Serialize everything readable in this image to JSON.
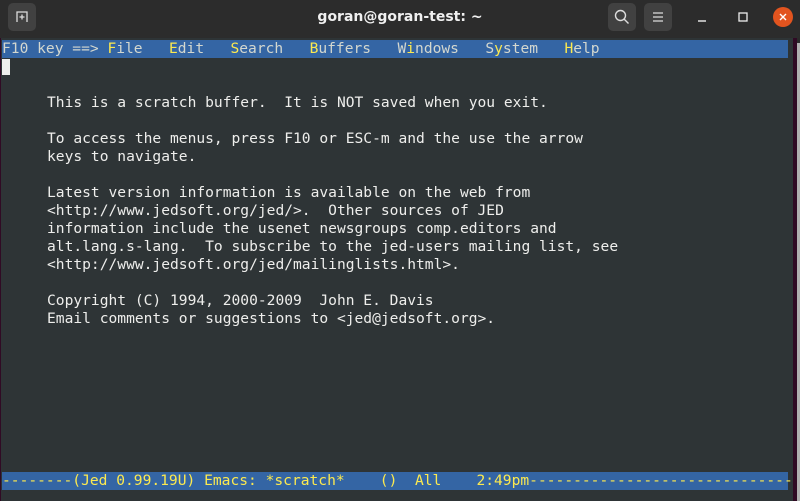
{
  "window": {
    "title": "goran@goran-test: ~",
    "icons": [
      "new-tab-icon",
      "search-icon",
      "hamburger-menu-icon",
      "minimize-icon",
      "maximize-icon",
      "close-icon"
    ]
  },
  "menubar": {
    "prefix": "F10 key ==> ",
    "items": [
      {
        "hot": "F",
        "rest": "ile",
        "sep": "   "
      },
      {
        "hot": "E",
        "rest": "dit",
        "sep": "   "
      },
      {
        "hot": "S",
        "rest": "earch",
        "sep": "   "
      },
      {
        "hot": "B",
        "rest": "uffers",
        "sep": "   "
      },
      {
        "pre": "W",
        "hot": "i",
        "rest": "ndows",
        "sep": "   "
      },
      {
        "pre": "S",
        "hot": "y",
        "rest": "stem",
        "sep": "   "
      },
      {
        "hot": "H",
        "rest": "elp",
        "sep": ""
      }
    ]
  },
  "buffer": {
    "lines": [
      "This is a scratch buffer.  It is NOT saved when you exit.",
      "",
      "To access the menus, press F10 or ESC-m and the use the arrow",
      "keys to navigate.",
      "",
      "Latest version information is available on the web from",
      "<http://www.jedsoft.org/jed/>.  Other sources of JED",
      "information include the usenet newsgroups comp.editors and",
      "alt.lang.s-lang.  To subscribe to the jed-users mailing list, see",
      "<http://www.jedsoft.org/jed/mailinglists.html>.",
      "",
      "Copyright (C) 1994, 2000-2009  John E. Davis",
      "Email comments or suggestions to <jed@jedsoft.org>."
    ]
  },
  "modeline": {
    "text": "--------(Jed 0.99.19U) Emacs: *scratch*    ()  All    2:49pm-----------------------------------"
  }
}
